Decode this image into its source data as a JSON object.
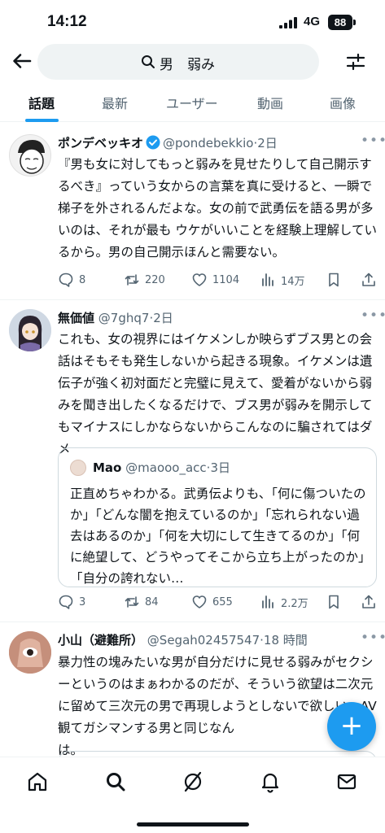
{
  "status_bar": {
    "time": "14:12",
    "network": "4G",
    "battery": "88"
  },
  "search": {
    "query": "男　弱み"
  },
  "tabs": [
    {
      "label": "話題",
      "active": true
    },
    {
      "label": "最新",
      "active": false
    },
    {
      "label": "ユーザー",
      "active": false
    },
    {
      "label": "動画",
      "active": false
    },
    {
      "label": "画像",
      "active": false
    }
  ],
  "posts": [
    {
      "name": "ポンデベッキオ",
      "verified": true,
      "handle": "@pondebekkio",
      "time": "2日",
      "text": "『男も女に対してもっと弱みを見せたりして自己開示するべき』っていう女からの言葉を真に受けると、一瞬で梯子を外されるんだよな。女の前で武勇伝を語る男が多いのは、それが最も ウケがいいことを経験上理解しているから。男の自己開示ほんと需要ない。",
      "replies": "8",
      "reposts": "220",
      "likes": "1104",
      "views": "14万"
    },
    {
      "name": "無価値",
      "handle": "@7ghq7",
      "time": "2日",
      "text": "これも、女の視界にはイケメンしか映らずブス男との会話はそもそも発生しないから起きる現象。イケメンは遺伝子が強く初対面だと完璧に見えて、愛着がないから弱みを聞き出したくなるだけで、ブス男が弱みを開示してもマイナスにしかならないからこんなのに騙されてはダメ",
      "quote": {
        "name": "Mao",
        "handle": "@maooo_acc",
        "time": "3日",
        "text": "正直めちゃわかる。武勇伝よりも、「何に傷ついたのか」「どんな闇を抱えているのか」「忘れられない過去はあるのか」「何を大切にして生きてるのか」「何に絶望して、どうやってそこから立ち上がったのか」「自分の誇れない…"
      },
      "replies": "3",
      "reposts": "84",
      "likes": "655",
      "views": "2.2万"
    },
    {
      "name": "小山（避難所）",
      "handle": "@Segah02457547",
      "time": "18 時間",
      "text": "暴力性の塊みたいな男が自分だけに見せる弱みがセクシーというのはまぁわかるのだが、そういう欲望は二次元に留めて三次元の男で再現しようとしないで欲しい。AV観てガシマンする男と同じなん\nは。"
    }
  ],
  "colors": {
    "accent": "#1d9bf0",
    "text": "#0f1419",
    "muted": "#536471"
  },
  "icons": {
    "back": "arrow-left-icon",
    "search": "search-icon",
    "filter": "sliders-icon",
    "fab": "plus-icon",
    "nav": [
      "home-icon",
      "search-icon",
      "grok-icon",
      "bell-icon",
      "mail-icon"
    ]
  },
  "fab_label": "+"
}
